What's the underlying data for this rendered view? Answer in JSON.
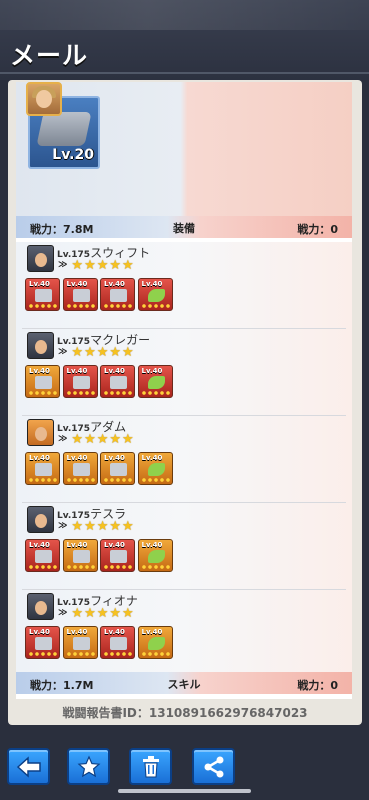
{
  "header": {
    "title": "メール"
  },
  "hero": {
    "vehicle_level": "Lv.20"
  },
  "equipment_bar": {
    "left": "戦力：7.8M",
    "center": "装備",
    "right": "戦力：0"
  },
  "skill_bar": {
    "left": "戦力：1.7M",
    "center": "スキル",
    "right": "戦力：0"
  },
  "heroes": [
    {
      "level": "Lv.175",
      "name": "スウィフト",
      "gear": [
        {
          "lv": "Lv.40",
          "color": "red",
          "icon": "weapon-icon"
        },
        {
          "lv": "Lv.40",
          "color": "red",
          "icon": "armor-icon"
        },
        {
          "lv": "Lv.40",
          "color": "red",
          "icon": "chip-icon"
        },
        {
          "lv": "Lv.40",
          "color": "red",
          "icon": "boots-icon"
        }
      ]
    },
    {
      "level": "Lv.175",
      "name": "マクレガー",
      "gear": [
        {
          "lv": "Lv.40",
          "color": "orange",
          "icon": "weapon-icon"
        },
        {
          "lv": "Lv.40",
          "color": "red",
          "icon": "armor-icon"
        },
        {
          "lv": "Lv.40",
          "color": "red",
          "icon": "chip-icon"
        },
        {
          "lv": "Lv.40",
          "color": "red",
          "icon": "boots-icon"
        }
      ]
    },
    {
      "level": "Lv.175",
      "name": "アダム",
      "gear": [
        {
          "lv": "Lv.40",
          "color": "orange",
          "icon": "weapon-icon"
        },
        {
          "lv": "Lv.40",
          "color": "orange",
          "icon": "armor-icon"
        },
        {
          "lv": "Lv.40",
          "color": "orange",
          "icon": "chip-icon"
        },
        {
          "lv": "Lv.40",
          "color": "orange",
          "icon": "boots-icon"
        }
      ]
    },
    {
      "level": "Lv.175",
      "name": "テスラ",
      "gear": [
        {
          "lv": "Lv.40",
          "color": "red",
          "icon": "weapon-icon"
        },
        {
          "lv": "Lv.40",
          "color": "orange",
          "icon": "armor-icon"
        },
        {
          "lv": "Lv.40",
          "color": "red",
          "icon": "chip-icon"
        },
        {
          "lv": "Lv.40",
          "color": "orange",
          "icon": "boots-icon"
        }
      ]
    },
    {
      "level": "Lv.175",
      "name": "フィオナ",
      "gear": [
        {
          "lv": "Lv.40",
          "color": "red",
          "icon": "weapon-icon"
        },
        {
          "lv": "Lv.40",
          "color": "orange",
          "icon": "armor-icon"
        },
        {
          "lv": "Lv.40",
          "color": "red",
          "icon": "chip-icon"
        },
        {
          "lv": "Lv.40",
          "color": "orange",
          "icon": "boots-icon"
        }
      ]
    }
  ],
  "report": {
    "id_text": "戦闘報告書ID：1310891662976847023"
  },
  "nav": {
    "buttons": [
      "back-arrow-icon",
      "star-icon",
      "trash-icon",
      "share-icon"
    ]
  },
  "colors": {
    "accent": "#2a86ee",
    "star": "#f6c220",
    "panel": "#e9e6df"
  }
}
